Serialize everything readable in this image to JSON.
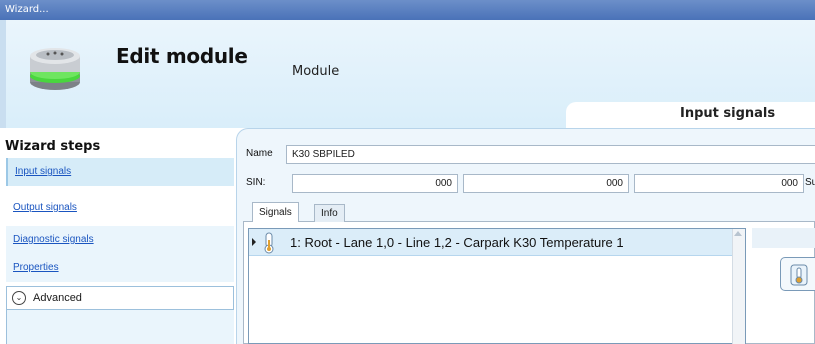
{
  "window": {
    "title": "Wizard..."
  },
  "header": {
    "title": "Edit module",
    "module_label": "Module",
    "tab_title": "Input signals",
    "module_icon": "module-device-icon"
  },
  "wizard_steps": {
    "title": "Wizard steps",
    "items": [
      {
        "label": "Input signals",
        "active": true
      },
      {
        "label": "Output signals"
      },
      {
        "label": "Diagnostic signals"
      },
      {
        "label": "Properties"
      }
    ],
    "advanced_label": "Advanced"
  },
  "form": {
    "name_label": "Name",
    "name_value": "K30 SBPILED",
    "sin_label": "SIN:",
    "sin_values": [
      "000",
      "000",
      "000"
    ],
    "sin_suffix": "Su"
  },
  "tabs": [
    {
      "label": "Signals",
      "selected": true
    },
    {
      "label": "Info",
      "selected": false
    }
  ],
  "signals": {
    "rows": [
      {
        "label": "1: Root - Lane 1,0 - Line 1,2 - Carpark K30 Temperature 1",
        "icon": "thermometer-icon"
      }
    ]
  },
  "colors": {
    "titlebar": "#4a72b8",
    "header_bg": "#d9eefa",
    "link": "#1a55c0",
    "selected_row": "#dbedf9"
  }
}
